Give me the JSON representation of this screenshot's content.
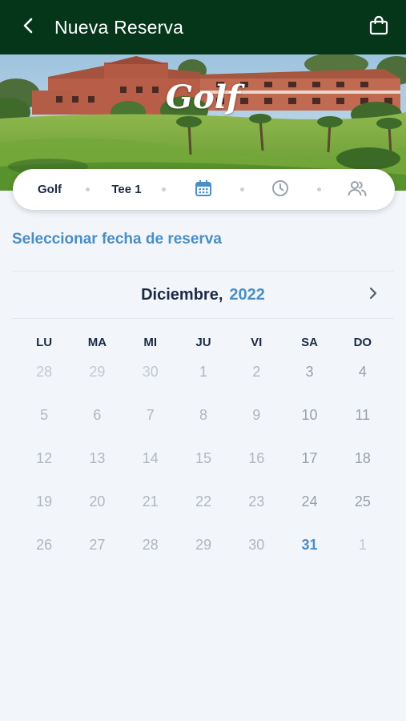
{
  "header": {
    "title": "Nueva Reserva",
    "back_icon": "chevron-left-icon",
    "cart_icon": "shopping-bag-icon",
    "background": "#05361a"
  },
  "hero": {
    "brand": "Golf"
  },
  "filters": {
    "sport": "Golf",
    "tee": "Tee 1",
    "date_icon": "calendar-icon",
    "time_icon": "clock-icon",
    "players_icon": "users-icon",
    "active_color": "#4a8ec5"
  },
  "section_title": "Seleccionar fecha de reserva",
  "calendar": {
    "month": "Diciembre,",
    "year": "2022",
    "next_icon": "chevron-right-icon",
    "weekdays": [
      "LU",
      "MA",
      "MI",
      "JU",
      "VI",
      "SA",
      "DO"
    ],
    "weeks": [
      [
        {
          "n": "28",
          "s": "muted"
        },
        {
          "n": "29",
          "s": "muted"
        },
        {
          "n": "30",
          "s": "muted"
        },
        {
          "n": "1",
          "s": "day"
        },
        {
          "n": "2",
          "s": "day"
        },
        {
          "n": "3",
          "s": "day-strong"
        },
        {
          "n": "4",
          "s": "day-strong"
        }
      ],
      [
        {
          "n": "5",
          "s": "day"
        },
        {
          "n": "6",
          "s": "day"
        },
        {
          "n": "7",
          "s": "day"
        },
        {
          "n": "8",
          "s": "day"
        },
        {
          "n": "9",
          "s": "day"
        },
        {
          "n": "10",
          "s": "day-strong"
        },
        {
          "n": "11",
          "s": "day-strong"
        }
      ],
      [
        {
          "n": "12",
          "s": "day"
        },
        {
          "n": "13",
          "s": "day"
        },
        {
          "n": "14",
          "s": "day"
        },
        {
          "n": "15",
          "s": "day"
        },
        {
          "n": "16",
          "s": "day"
        },
        {
          "n": "17",
          "s": "day-strong"
        },
        {
          "n": "18",
          "s": "day-strong"
        }
      ],
      [
        {
          "n": "19",
          "s": "day"
        },
        {
          "n": "20",
          "s": "day"
        },
        {
          "n": "21",
          "s": "day"
        },
        {
          "n": "22",
          "s": "day"
        },
        {
          "n": "23",
          "s": "day"
        },
        {
          "n": "24",
          "s": "day-strong"
        },
        {
          "n": "25",
          "s": "day-strong"
        }
      ],
      [
        {
          "n": "26",
          "s": "day"
        },
        {
          "n": "27",
          "s": "day"
        },
        {
          "n": "28",
          "s": "day"
        },
        {
          "n": "29",
          "s": "day"
        },
        {
          "n": "30",
          "s": "day"
        },
        {
          "n": "31",
          "s": "day-selected"
        },
        {
          "n": "1",
          "s": "muted"
        }
      ]
    ]
  }
}
